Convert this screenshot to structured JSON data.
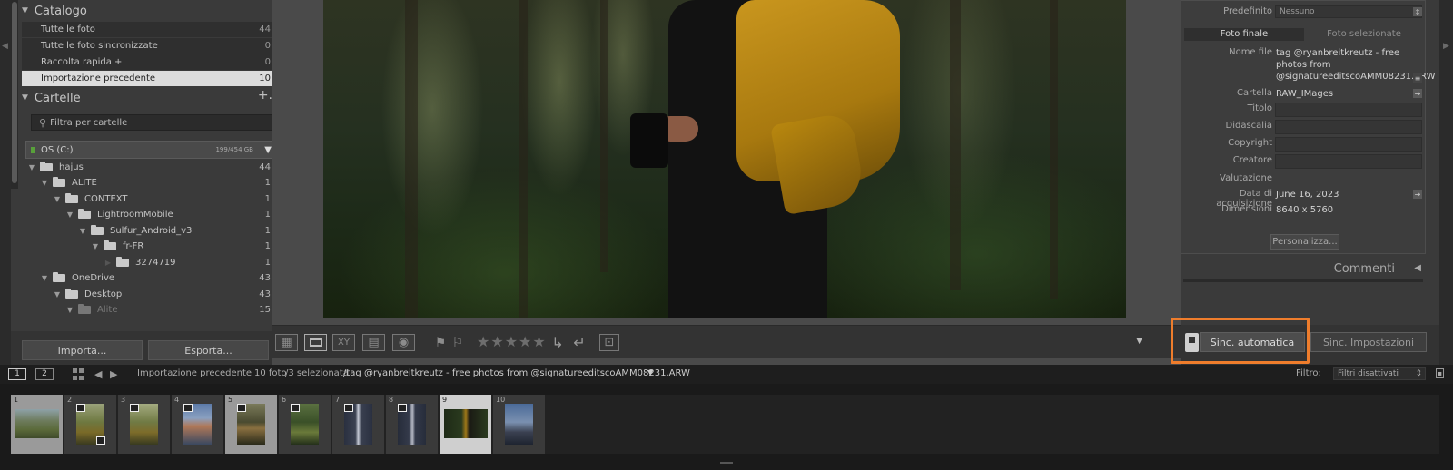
{
  "left_panel": {
    "catalog": {
      "title": "Catalogo",
      "items": [
        {
          "label": "Tutte le foto",
          "count": "44"
        },
        {
          "label": "Tutte le foto sincronizzate",
          "count": "0"
        },
        {
          "label": "Raccolta rapida +",
          "count": "0"
        },
        {
          "label": "Importazione precedente",
          "count": "10",
          "selected": true
        }
      ]
    },
    "folders": {
      "title": "Cartelle",
      "add_label": "+.",
      "filter_placeholder": "Filtra per cartelle",
      "drive": {
        "name": "OS (C:)",
        "size": "199/454 GB"
      },
      "tree": [
        {
          "label": "hajus",
          "count": "44"
        },
        {
          "label": "ALITE",
          "count": "1"
        },
        {
          "label": "CONTEXT",
          "count": "1"
        },
        {
          "label": "LightroomMobile",
          "count": "1"
        },
        {
          "label": "Sulfur_Android_v3",
          "count": "1"
        },
        {
          "label": "fr-FR",
          "count": "1"
        },
        {
          "label": "3274719",
          "count": "1"
        },
        {
          "label": "OneDrive",
          "count": "43"
        },
        {
          "label": "Desktop",
          "count": "43"
        },
        {
          "label": "Alite",
          "count": "15"
        }
      ]
    },
    "import_label": "Importa...",
    "export_label": "Esporta..."
  },
  "toolbar": {
    "stars": "★★★★★"
  },
  "right_panel": {
    "preset": {
      "label": "Predefinito",
      "value": "Nessuno"
    },
    "tabs": [
      "Foto finale",
      "Foto selezionate"
    ],
    "fields": [
      {
        "label": "Nome file",
        "value": "tag @ryanbreitkreutz - free photos from @signatureeditscoAMM08231.ARW"
      },
      {
        "label": "Cartella",
        "value": "RAW_IMages"
      },
      {
        "label": "Titolo",
        "value": ""
      },
      {
        "label": "Didascalia",
        "value": ""
      },
      {
        "label": "Copyright",
        "value": ""
      },
      {
        "label": "Creatore",
        "value": ""
      },
      {
        "label": "Valutazione",
        "value": ""
      },
      {
        "label": "Data di acquisizione",
        "value": "June 16, 2023"
      },
      {
        "label": "Dimensioni",
        "value": "8640 x 5760"
      }
    ],
    "customize_label": "Personalizza...",
    "comments_title": "Commenti",
    "sync_auto_label": "Sinc. automatica",
    "sync_settings_label": "Sinc. Impostazioni"
  },
  "film_bar": {
    "view1": "1",
    "view2": "2",
    "source": "Importazione precedente",
    "count_text": "10 foto",
    "selected_text": "/3 selezionata",
    "path_text": "/tag @ryanbreitkreutz - free photos from @signatureeditscoAMM08231.ARW",
    "filter_label": "Filtro:",
    "filter_value": "Filtri disattivati"
  },
  "filmstrip": {
    "cells": [
      {
        "n": "1"
      },
      {
        "n": "2"
      },
      {
        "n": "3"
      },
      {
        "n": "4"
      },
      {
        "n": "5"
      },
      {
        "n": "6"
      },
      {
        "n": "7"
      },
      {
        "n": "8"
      },
      {
        "n": "9"
      },
      {
        "n": "10"
      }
    ]
  },
  "colors": {
    "highlight": "#ef7d2c",
    "panel": "#3a3a3a",
    "selected_row": "#dcdcdc"
  }
}
